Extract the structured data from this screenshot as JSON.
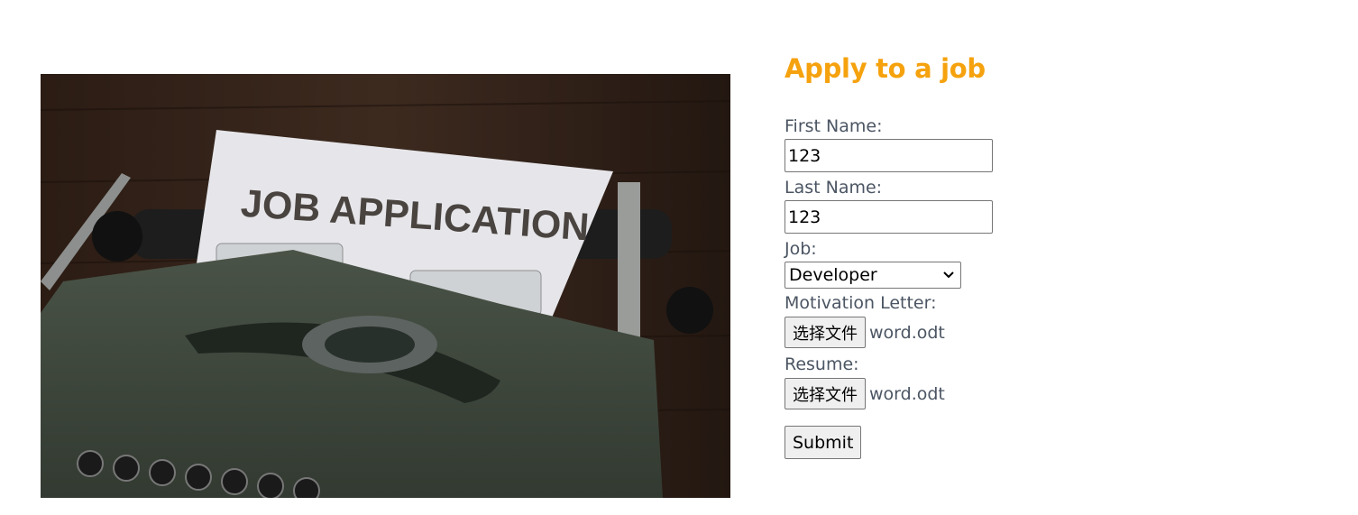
{
  "form": {
    "heading": "Apply to a job",
    "first_name": {
      "label": "First Name:",
      "value": "123"
    },
    "last_name": {
      "label": "Last Name:",
      "value": "123"
    },
    "job": {
      "label": "Job:",
      "selected": "Developer"
    },
    "motivation_letter": {
      "label": "Motivation Letter:",
      "button": "选择文件",
      "file": "word.odt"
    },
    "resume": {
      "label": "Resume:",
      "button": "选择文件",
      "file": "word.odt"
    },
    "submit": "Submit"
  },
  "photo": {
    "paper_text": "JOB APPLICATION"
  },
  "colors": {
    "heading": "#f5a20e",
    "label": "#4b5563",
    "typewriter": "#3c4538"
  }
}
